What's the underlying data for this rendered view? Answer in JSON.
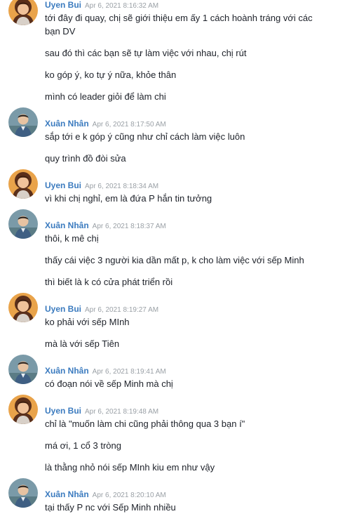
{
  "messages": [
    {
      "kind": "head",
      "sender": "uyen",
      "name": "Uyen Bui",
      "time": "Apr 6, 2021 8:16:32 AM"
    },
    {
      "kind": "text",
      "text": "tới đây đi quay, chị sẽ giới thiệu em ấy 1 cách hoành tráng với các bạn DV"
    },
    {
      "kind": "text",
      "text": "sau đó thì các bạn sẽ tự làm việc với nhau, chị rút"
    },
    {
      "kind": "text",
      "text": "ko góp ý, ko tự ý nữa, khỏe thân"
    },
    {
      "kind": "text",
      "text": "mình có leader giỏi để làm chi"
    },
    {
      "kind": "head",
      "sender": "nhan",
      "name": "Xuân Nhân",
      "time": "Apr 6, 2021 8:17:50 AM"
    },
    {
      "kind": "text",
      "text": "sắp tới e k góp ý cũng như chỉ cách làm việc luôn"
    },
    {
      "kind": "text",
      "text": "quy trình đồ đòi sửa"
    },
    {
      "kind": "head",
      "sender": "uyen",
      "name": "Uyen Bui",
      "time": "Apr 6, 2021 8:18:34 AM"
    },
    {
      "kind": "text",
      "text": "vì khi chị nghỉ, em là đứa P hắn tin tưởng"
    },
    {
      "kind": "head",
      "sender": "nhan",
      "name": "Xuân Nhân",
      "time": "Apr 6, 2021 8:18:37 AM"
    },
    {
      "kind": "text",
      "text": "thôi, k mê chị"
    },
    {
      "kind": "text",
      "text": "thấy cái việc 3 người kia dần mất p, k cho làm việc với sếp Minh"
    },
    {
      "kind": "text",
      "text": "thì biết là k có cửa phát triển rồi"
    },
    {
      "kind": "head",
      "sender": "uyen",
      "name": "Uyen Bui",
      "time": "Apr 6, 2021 8:19:27 AM"
    },
    {
      "kind": "text",
      "text": "ko phải với sếp MInh"
    },
    {
      "kind": "text",
      "text": "mà là với sếp Tiên"
    },
    {
      "kind": "head",
      "sender": "nhan",
      "name": "Xuân Nhân",
      "time": "Apr 6, 2021 8:19:41 AM"
    },
    {
      "kind": "text",
      "text": "có đoạn nói về sếp Minh mà chị"
    },
    {
      "kind": "head",
      "sender": "uyen",
      "name": "Uyen Bui",
      "time": "Apr 6, 2021 8:19:48 AM"
    },
    {
      "kind": "text",
      "text": "chỉ là \"muốn làm chi cũng phải thông qua 3 bạn í\""
    },
    {
      "kind": "text",
      "text": "má ơi, 1 cổ 3 tròng"
    },
    {
      "kind": "text",
      "text": "là thằng nhỏ nói sếp MInh kiu em như vậy"
    },
    {
      "kind": "head",
      "sender": "nhan",
      "name": "Xuân Nhân",
      "time": "Apr 6, 2021 8:20:10 AM"
    },
    {
      "kind": "text",
      "text": "tại thấy P nc với Sếp Minh nhiều"
    }
  ],
  "colors": {
    "name": "#3b7bbf",
    "time": "#9aa0a6",
    "text": "#1d2129"
  },
  "icons": {
    "uyen": "avatar-woman-icon",
    "nhan": "avatar-man-icon"
  }
}
